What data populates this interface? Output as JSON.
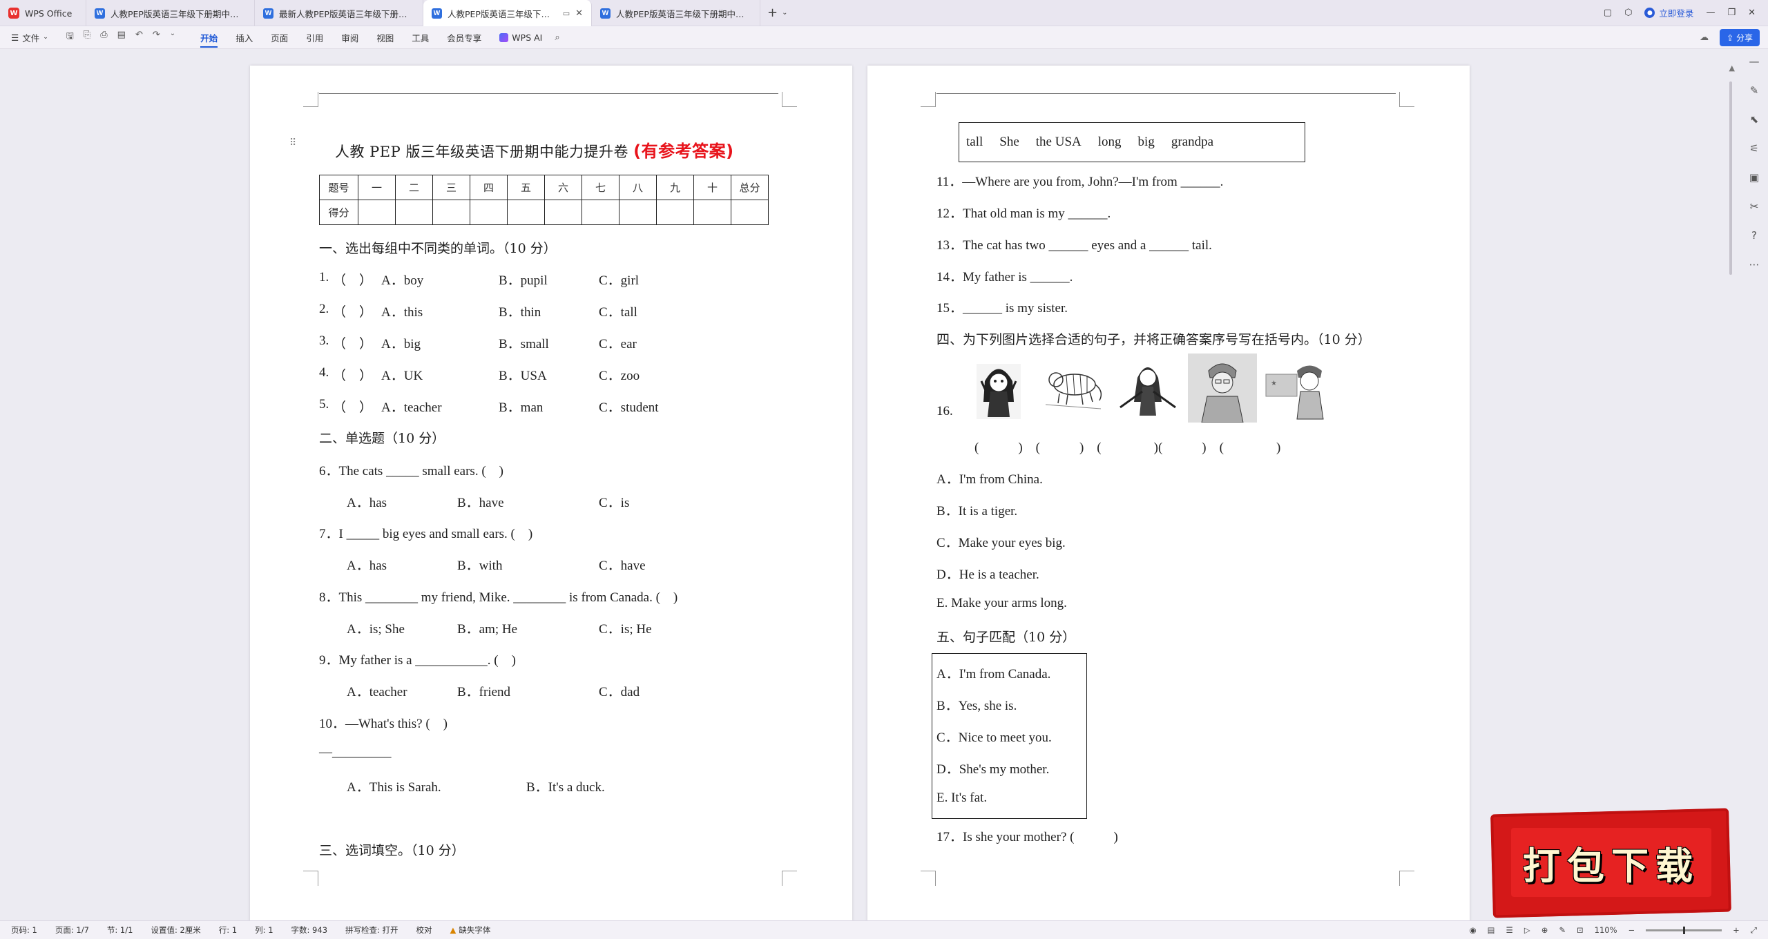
{
  "tabs": [
    {
      "label": "WPS Office",
      "type": "home"
    },
    {
      "label": "人教PEP版英语三年级下册期中基础",
      "type": "doc"
    },
    {
      "label": "最新人教PEP版英语三年级下册期中综合",
      "type": "doc"
    },
    {
      "label": "人教PEP版英语三年级下册期中",
      "type": "doc",
      "active": true
    },
    {
      "label": "人教PEP版英语三年级下册期中综合素",
      "type": "doc"
    }
  ],
  "titlebar": {
    "login": "立即登录",
    "add_tab": "+"
  },
  "ribbon": {
    "file": "文件",
    "menu": [
      "开始",
      "插入",
      "页面",
      "引用",
      "审阅",
      "视图",
      "工具",
      "会员专享"
    ],
    "ai": "WPS AI",
    "share": "分享"
  },
  "page1": {
    "title": "人教 PEP 版三年级英语下册期中能力提升卷",
    "title_red": "(有参考答案)",
    "score_header": [
      "题号",
      "一",
      "二",
      "三",
      "四",
      "五",
      "六",
      "七",
      "八",
      "九",
      "十",
      "总分"
    ],
    "score_row_label": "得分",
    "sec1": "一、选出每组中不同类的单词。（10 分）",
    "q1_5": [
      {
        "num": "1.",
        "paren": "（　）",
        "a": "A．boy",
        "b": "B．pupil",
        "c": "C．girl"
      },
      {
        "num": "2.",
        "paren": "（　）",
        "a": "A．this",
        "b": "B．thin",
        "c": "C．tall"
      },
      {
        "num": "3.",
        "paren": "（　）",
        "a": "A．big",
        "b": "B．small",
        "c": "C．ear"
      },
      {
        "num": "4.",
        "paren": "（　）",
        "a": "A．UK",
        "b": "B．USA",
        "c": "C．zoo"
      },
      {
        "num": "5.",
        "paren": "（　）",
        "a": "A．teacher",
        "b": "B．man",
        "c": "C．student"
      }
    ],
    "sec2": "二、单选题（10 分）",
    "q6": "6．The cats _____ small ears. (　)",
    "q6_opts": [
      "A．has",
      "B．have",
      "C．is"
    ],
    "q7": "7．I _____ big eyes and small ears. (　)",
    "q7_opts": [
      "A．has",
      "B．with",
      "C．have"
    ],
    "q8": "8．This ________ my friend, Mike. ________ is from Canada. (　)",
    "q8_opts": [
      "A．is; She",
      "B．am; He",
      "C．is; He"
    ],
    "q9": "9．My father is a ___________. (　)",
    "q9_opts": [
      "A．teacher",
      "B．friend",
      "C．dad"
    ],
    "q10": "10．—What's this? (　)",
    "q10_blank": "—_________",
    "q10_opts": [
      "A．This is Sarah.",
      "B．It's a duck."
    ],
    "sec3": "三、选词填空。（10 分）"
  },
  "page2": {
    "words": [
      "tall",
      "She",
      "the USA",
      "long",
      "big",
      "grandpa"
    ],
    "q11": "11．—Where are you from, John?—I'm from ______.",
    "q12": "12．That old man is my ______.",
    "q13": "13．The cat has two ______ eyes and a ______ tail.",
    "q14": "14．My father is ______.",
    "q15": "15．______ is my sister.",
    "sec4": "四、为下列图片选择合适的句子，并将正确答案序号写在括号内。（10 分）",
    "q16": "16.",
    "q16_parens": "(　　　)　(　　　)　(　　　　)(　　　)　(　　　　)",
    "opts4": [
      "A．I'm from China.",
      "B．It is a tiger.",
      "C．Make your eyes big.",
      "D．He is a teacher.",
      "E. Make your arms long."
    ],
    "sec5": "五、句子匹配（10 分）",
    "match": [
      "A．I'm from Canada.",
      "B．Yes, she is.",
      "C．Nice to meet you.",
      "D．She's my mother.",
      "E. It's fat."
    ],
    "q17": "17．Is she your mother? (　　　)"
  },
  "status": {
    "page_num": "页码: 1",
    "pages": "页面: 1/7",
    "section": "节: 1/1",
    "setting": "设置值: 2厘米",
    "row": "行: 1",
    "col": "列: 1",
    "words": "字数: 943",
    "spell": "拼写检查: 打开",
    "proof": "校对",
    "missing_font": "缺失字体",
    "zoom": "110%"
  },
  "promo": {
    "text": "打包下载"
  }
}
